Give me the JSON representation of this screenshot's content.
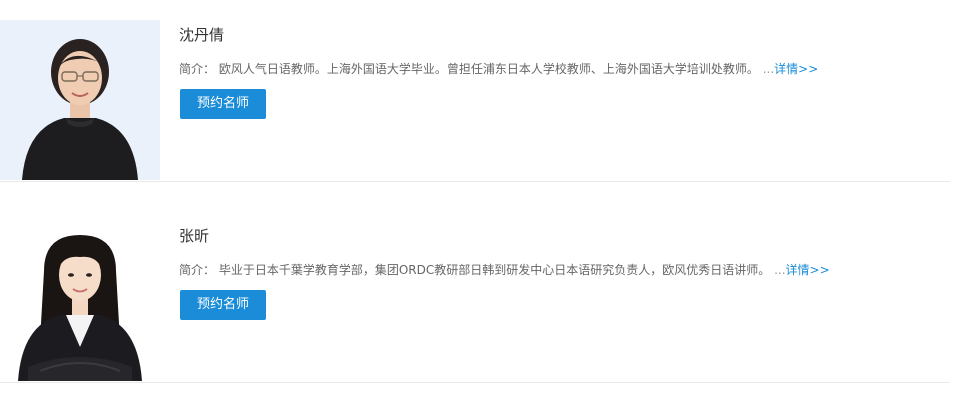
{
  "teachers": [
    {
      "name": "沈丹倩",
      "intro_label": "简介：",
      "intro_text": "欧风人气日语教师。上海外国语大学毕业。曾担任浦东日本人学校教师、上海外国语大学培训处教师。",
      "ellipsis": "...",
      "more_link": "详情>>",
      "book_button": "预约名师"
    },
    {
      "name": "张昕",
      "intro_label": "简介：",
      "intro_text": "毕业于日本千葉学教育学部，集团ORDC教研部日韩到研发中心日本语研究负责人，欧风优秀日语讲师。",
      "ellipsis": "...",
      "more_link": "详情>>",
      "book_button": "预约名师"
    }
  ],
  "colors": {
    "accent": "#1a8cd8",
    "photo_bg": "#eaf1fb",
    "divider": "#e9e9e9"
  }
}
